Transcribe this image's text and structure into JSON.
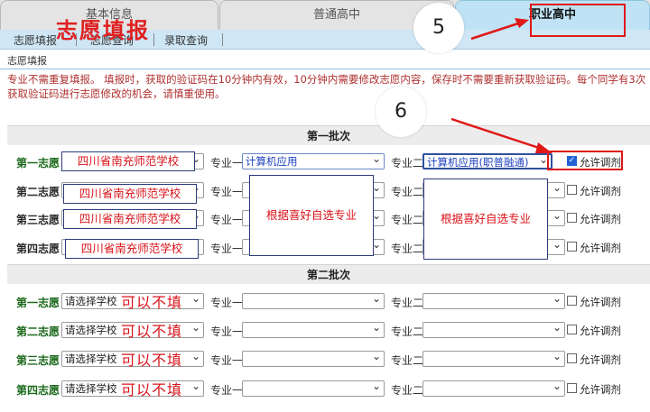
{
  "tabs": [
    "基本信息",
    "普通高中",
    "职业高中"
  ],
  "subnav": [
    "志愿填报",
    "志愿查询",
    "录取查询"
  ],
  "crumb": "志愿填报",
  "notice": "专业不需重复填报。 填报时，获取的验证码在10分钟内有效，10分钟内需要修改志愿内容，保存时不需要重新获取验证码。每个同学有3次获取验证码进行志愿修改的机会，请慎重使用。",
  "batches": [
    "第一批次",
    "第二批次"
  ],
  "labels": {
    "major1": "专业一",
    "major2": "专业二",
    "allow": "允许调剂"
  },
  "batch1": [
    {
      "label": "第一志愿",
      "school": "",
      "major1": "计算机应用",
      "major2": "计算机应用(职普融通)",
      "checked": true
    },
    {
      "label": "第二志愿",
      "school": "",
      "major1": "",
      "major2": "",
      "checked": false
    },
    {
      "label": "第三志愿",
      "school": "",
      "major1": "",
      "major2": "",
      "checked": false
    },
    {
      "label": "第四志愿",
      "school": "",
      "major1": "",
      "major2": "",
      "checked": false
    }
  ],
  "batch2": [
    {
      "label": "第一志愿",
      "school": "请选择学校",
      "checked": false
    },
    {
      "label": "第二志愿",
      "school": "请选择学校",
      "checked": false
    },
    {
      "label": "第三志愿",
      "school": "请选择学校",
      "checked": false
    },
    {
      "label": "第四志愿",
      "school": "请选择学校",
      "checked": false
    }
  ],
  "annotations": {
    "title": "志愿填报",
    "step5": "5",
    "step6": "6",
    "school_names": [
      "四川省南充师范学校",
      "四川省南充师范学校",
      "四川省南充师范学校",
      "四川省南充师范学校"
    ],
    "major_note_1": "根据喜好自选专业",
    "major_note_2": "根据喜好自选专业",
    "optional": "可以不填"
  },
  "colors": {
    "active_tab": "#bfe3f5",
    "annotation_red": "#e01818",
    "first_label_green": "#1d6a1d"
  }
}
